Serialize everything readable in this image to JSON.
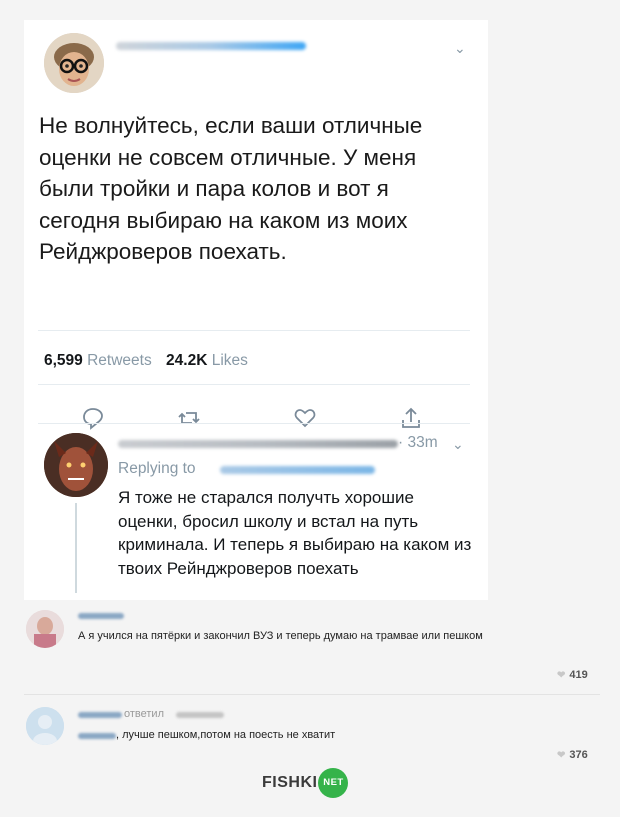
{
  "tweet": {
    "text": "Не волнуйтесь, если ваши отличные оценки не совсем отличные. У меня были тройки и пара колов и вот я сегодня выбираю на каком из моих Рейджроверов поехать.",
    "retweets_count": "6,599",
    "retweets_label": "Retweets",
    "likes_count": "24.2K",
    "likes_label": "Likes",
    "actions": [
      "reply-icon",
      "retweet-icon",
      "like-icon",
      "share-icon"
    ]
  },
  "reply": {
    "time": "· 33m",
    "replying_label": "Replying to",
    "text": "Я тоже не старался получть хорошие оценки, бросил школу и встал на путь криминала. И теперь я выбираю на каком из твоих Рейнджроверов поехать"
  },
  "comments": [
    {
      "text": "А я учился на пятёрки и закончил ВУЗ и теперь думаю на трамвае или пешком",
      "likes": "419"
    },
    {
      "reply_label": "ответил",
      "text": ", лучше пешком,потом на поесть не хватит",
      "likes": "376"
    }
  ],
  "watermark": {
    "brand": "FISHKI",
    "badge": "NET",
    "badge_color": "#35b34a"
  }
}
